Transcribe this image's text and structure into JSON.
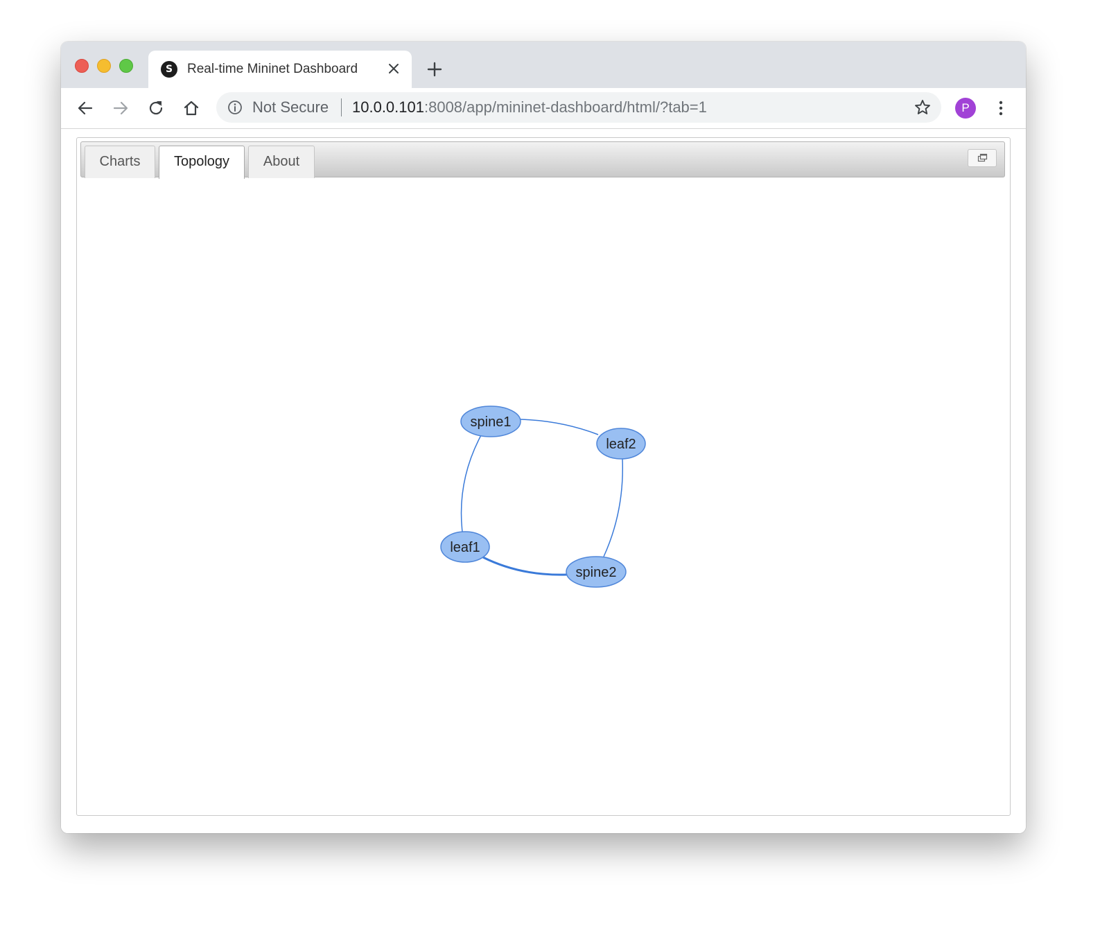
{
  "browser": {
    "tab_title": "Real-time Mininet Dashboard",
    "favicon_letter": "S",
    "security_label": "Not Secure",
    "url_host": "10.0.0.101",
    "url_rest": ":8008/app/mininet-dashboard/html/?tab=1",
    "profile_initial": "P"
  },
  "app": {
    "tabs": [
      {
        "label": "Charts",
        "active": false
      },
      {
        "label": "Topology",
        "active": true
      },
      {
        "label": "About",
        "active": false
      }
    ]
  },
  "topology": {
    "nodes": [
      {
        "id": "spine1",
        "label": "spine1"
      },
      {
        "id": "leaf2",
        "label": "leaf2"
      },
      {
        "id": "leaf1",
        "label": "leaf1"
      },
      {
        "id": "spine2",
        "label": "spine2"
      }
    ],
    "links": [
      {
        "source": "spine1",
        "target": "leaf2"
      },
      {
        "source": "spine1",
        "target": "leaf1"
      },
      {
        "source": "leaf2",
        "target": "spine2"
      },
      {
        "source": "leaf1",
        "target": "spine2",
        "emphasized": true
      }
    ],
    "colors": {
      "node_fill": "#99bff2",
      "node_stroke": "#4f86d9",
      "link": "#3a7ad9"
    }
  }
}
